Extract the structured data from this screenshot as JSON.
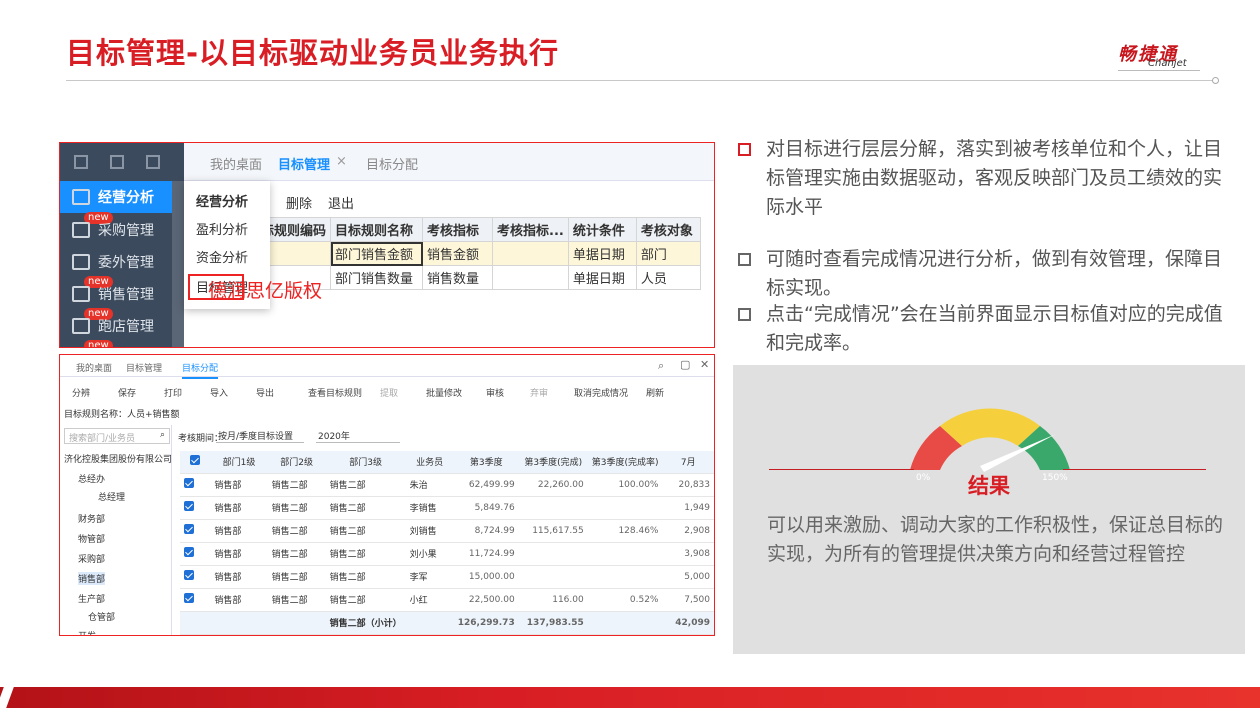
{
  "slide": {
    "title": "目标管理-以目标驱动业务员业务执行",
    "logo_cn": "畅捷通",
    "logo_en": "Chanjet"
  },
  "shot1": {
    "sidebar": [
      {
        "label": "经营分析",
        "active": true
      },
      {
        "label": "采购管理",
        "badge": "new"
      },
      {
        "label": "委外管理"
      },
      {
        "label": "销售管理",
        "badge": "new"
      },
      {
        "label": "跑店管理",
        "badge": "new"
      }
    ],
    "extra_badge": "new",
    "tabs": [
      "我的桌面",
      "目标管理",
      "目标分配"
    ],
    "tab_close": "×",
    "toolbar": [
      "删除",
      "退出"
    ],
    "menu": [
      "经营分析",
      "盈利分析",
      "资金分析",
      "目标管理"
    ],
    "watermark": "德润思亿版权",
    "columns": [
      "标规则编码",
      "目标规则名称",
      "考核指标",
      "考核指标...",
      "统计条件",
      "考核对象"
    ],
    "rows": [
      [
        "",
        "部门销售金额",
        "销售金额",
        "",
        "单据日期",
        "部门"
      ],
      [
        "",
        "部门销售数量",
        "销售数量",
        "",
        "单据日期",
        "人员"
      ]
    ]
  },
  "shot2": {
    "tabs": [
      "我的桌面",
      "目标管理",
      "目标分配"
    ],
    "window_icons": [
      "search-icon",
      "restore-icon",
      "close-icon"
    ],
    "toolbar": [
      "分辨",
      "保存",
      "打印",
      "导入",
      "导出",
      "查看目标规则",
      "提取",
      "批量修改",
      "审核",
      "弃审",
      "取消完成情况",
      "刷新"
    ],
    "rule_label": "目标规则名称：人员+销售额",
    "tree_search": "搜索部门/业务员",
    "period_label": "考核期间：",
    "period_value": "按月/季度目标设置",
    "year_value": "2020年",
    "tree": [
      "济化控股集团股份有限公司",
      "总经办",
      "总经理",
      "财务部",
      "物管部",
      "采购部",
      "销售部",
      "生产部",
      "仓管部",
      "开发",
      "分部"
    ],
    "columns": [
      "部门1级",
      "部门2级",
      "部门3级",
      "业务员",
      "第3季度",
      "第3季度(完成)",
      "第3季度(完成率)",
      "7月"
    ],
    "rows": [
      [
        "销售部",
        "销售二部",
        "销售二部",
        "朱治",
        "62,499.99",
        "22,260.00",
        "100.00%",
        "20,833"
      ],
      [
        "销售部",
        "销售二部",
        "销售二部",
        "李销售",
        "5,849.76",
        "",
        "",
        "1,949"
      ],
      [
        "销售部",
        "销售二部",
        "销售二部",
        "刘销售",
        "8,724.99",
        "115,617.55",
        "128.46%",
        "2,908"
      ],
      [
        "销售部",
        "销售二部",
        "销售二部",
        "刘小果",
        "11,724.99",
        "",
        "",
        "3,908"
      ],
      [
        "销售部",
        "销售二部",
        "销售二部",
        "李军",
        "15,000.00",
        "",
        "",
        "5,000"
      ],
      [
        "销售部",
        "销售二部",
        "销售二部",
        "小红",
        "22,500.00",
        "116.00",
        "0.52%",
        "7,500"
      ]
    ],
    "total": [
      "",
      "",
      "销售二部（小计）",
      "",
      "126,299.73",
      "137,983.55",
      "",
      "42,099"
    ]
  },
  "bullets": [
    "对目标进行层层分解，落实到被考核单位和个人，让目标管理实施由数据驱动，客观反映部门及员工绩效的实际水平",
    "可随时查看完成情况进行分析，做到有效管理，保障目标实现。",
    "点击“完成情况”会在当前界面显示目标值对应的完成值和完成率。"
  ],
  "result": {
    "gauge_min": "0%",
    "gauge_max": "150%",
    "title": "结果",
    "text": "可以用来激励、调动大家的工作积极性，保证总目标的实现，为所有的管理提供决策方向和经营过程管控"
  },
  "colors": {
    "brand_red": "#d81e24",
    "gauge_red": "#e84a46",
    "gauge_yellow": "#f5d03c",
    "gauge_green": "#3aa86a"
  }
}
